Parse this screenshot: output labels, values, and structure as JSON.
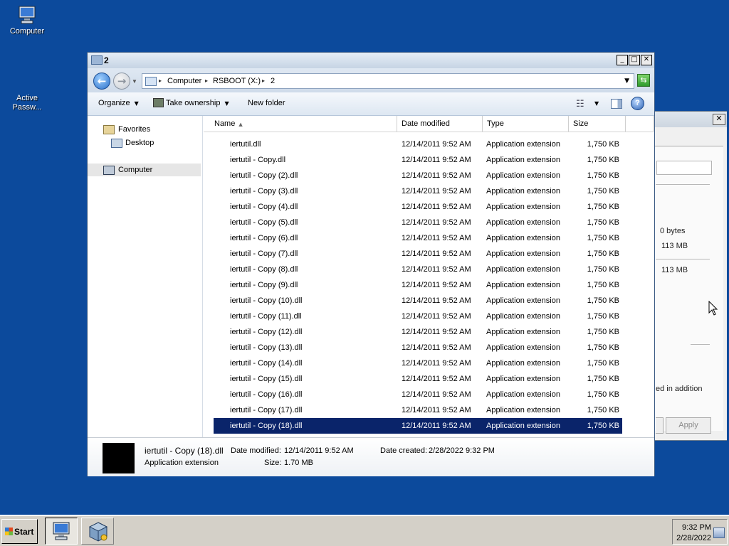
{
  "desktop": {
    "icons": [
      {
        "label_line1": "Computer",
        "label_line2": ""
      },
      {
        "label_line1": "Active",
        "label_line2": "Passw..."
      }
    ]
  },
  "background_dialog": {
    "close": "✕",
    "text_1": "0 bytes",
    "text_2": "113 MB",
    "text_3": "113 MB",
    "text_4": "ed in addition",
    "apply_label": "Apply"
  },
  "window": {
    "title": "2",
    "controls": {
      "minimize": "_",
      "maximize": "□",
      "close": "✕"
    },
    "address": {
      "crumbs": [
        "Computer",
        "RSBOOT (X:)",
        "2"
      ],
      "separator": "▸"
    },
    "toolbar": {
      "organize": "Organize",
      "take_ownership": "Take ownership",
      "new_folder": "New folder",
      "help": "?"
    },
    "nav_pane": {
      "favorites": "Favorites",
      "desktop": "Desktop",
      "computer": "Computer"
    },
    "columns": {
      "name": "Name",
      "date_modified": "Date modified",
      "type": "Type",
      "size": "Size"
    },
    "files": [
      {
        "name": "iertutil.dll",
        "date": "12/14/2011 9:52 AM",
        "type": "Application extension",
        "size": "1,750 KB"
      },
      {
        "name": "iertutil - Copy.dll",
        "date": "12/14/2011 9:52 AM",
        "type": "Application extension",
        "size": "1,750 KB"
      },
      {
        "name": "iertutil - Copy (2).dll",
        "date": "12/14/2011 9:52 AM",
        "type": "Application extension",
        "size": "1,750 KB"
      },
      {
        "name": "iertutil - Copy (3).dll",
        "date": "12/14/2011 9:52 AM",
        "type": "Application extension",
        "size": "1,750 KB"
      },
      {
        "name": "iertutil - Copy (4).dll",
        "date": "12/14/2011 9:52 AM",
        "type": "Application extension",
        "size": "1,750 KB"
      },
      {
        "name": "iertutil - Copy (5).dll",
        "date": "12/14/2011 9:52 AM",
        "type": "Application extension",
        "size": "1,750 KB"
      },
      {
        "name": "iertutil - Copy (6).dll",
        "date": "12/14/2011 9:52 AM",
        "type": "Application extension",
        "size": "1,750 KB"
      },
      {
        "name": "iertutil - Copy (7).dll",
        "date": "12/14/2011 9:52 AM",
        "type": "Application extension",
        "size": "1,750 KB"
      },
      {
        "name": "iertutil - Copy (8).dll",
        "date": "12/14/2011 9:52 AM",
        "type": "Application extension",
        "size": "1,750 KB"
      },
      {
        "name": "iertutil - Copy (9).dll",
        "date": "12/14/2011 9:52 AM",
        "type": "Application extension",
        "size": "1,750 KB"
      },
      {
        "name": "iertutil - Copy (10).dll",
        "date": "12/14/2011 9:52 AM",
        "type": "Application extension",
        "size": "1,750 KB"
      },
      {
        "name": "iertutil - Copy (11).dll",
        "date": "12/14/2011 9:52 AM",
        "type": "Application extension",
        "size": "1,750 KB"
      },
      {
        "name": "iertutil - Copy (12).dll",
        "date": "12/14/2011 9:52 AM",
        "type": "Application extension",
        "size": "1,750 KB"
      },
      {
        "name": "iertutil - Copy (13).dll",
        "date": "12/14/2011 9:52 AM",
        "type": "Application extension",
        "size": "1,750 KB"
      },
      {
        "name": "iertutil - Copy (14).dll",
        "date": "12/14/2011 9:52 AM",
        "type": "Application extension",
        "size": "1,750 KB"
      },
      {
        "name": "iertutil - Copy (15).dll",
        "date": "12/14/2011 9:52 AM",
        "type": "Application extension",
        "size": "1,750 KB"
      },
      {
        "name": "iertutil - Copy (16).dll",
        "date": "12/14/2011 9:52 AM",
        "type": "Application extension",
        "size": "1,750 KB"
      },
      {
        "name": "iertutil - Copy (17).dll",
        "date": "12/14/2011 9:52 AM",
        "type": "Application extension",
        "size": "1,750 KB"
      },
      {
        "name": "iertutil - Copy (18).dll",
        "date": "12/14/2011 9:52 AM",
        "type": "Application extension",
        "size": "1,750 KB",
        "selected": true
      }
    ],
    "details": {
      "name": "iertutil - Copy (18).dll",
      "type": "Application extension",
      "date_modified_label": "Date modified:",
      "date_modified": "12/14/2011 9:52 AM",
      "date_created_label": "Date created:",
      "date_created": "2/28/2022 9:32 PM",
      "size_label": "Size:",
      "size": "1.70 MB"
    }
  },
  "taskbar": {
    "start": "Start",
    "time": "9:32 PM",
    "date": "2/28/2022"
  },
  "colors": {
    "desktop": "#0c4a9c",
    "selection": "#0a246a",
    "taskbar": "#d4d0c8"
  }
}
